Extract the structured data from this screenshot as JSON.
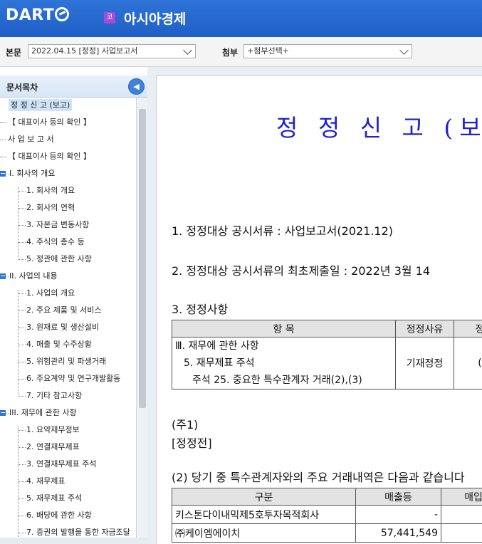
{
  "header": {
    "logo": "DART",
    "company_badge": "코",
    "company_name": "아시아경제"
  },
  "selectors": {
    "main_label": "본문",
    "main_value": "2022.04.15  [정정] 사업보고서",
    "attach_label": "첨부",
    "attach_value": "+첨부선택+"
  },
  "sidebar": {
    "title": "문서목차",
    "items": [
      {
        "label": "정 정 신 고 (보고)"
      },
      {
        "label": "【 대표이사 등의 확인 】"
      },
      {
        "label": "사 업 보 고 서"
      },
      {
        "label": "【 대표이사 등의 확인 】"
      },
      {
        "label": "I. 회사의 개요"
      },
      {
        "label": "1. 회사의 개요"
      },
      {
        "label": "2. 회사의 연혁"
      },
      {
        "label": "3. 자본금 변동사항"
      },
      {
        "label": "4. 주식의 총수 등"
      },
      {
        "label": "5. 정관에 관한 사항"
      },
      {
        "label": "II. 사업의 내용"
      },
      {
        "label": "1. 사업의 개요"
      },
      {
        "label": "2. 주요 제품 및 서비스"
      },
      {
        "label": "3. 원재료 및 생산설비"
      },
      {
        "label": "4. 매출 및 수주상황"
      },
      {
        "label": "5. 위험관리 및 파생거래"
      },
      {
        "label": "6. 주요계약 및 연구개발활동"
      },
      {
        "label": "7. 기타 참고사항"
      },
      {
        "label": "III. 재무에 관한 사항"
      },
      {
        "label": "1. 요약재무정보"
      },
      {
        "label": "2. 연결재무제표"
      },
      {
        "label": "3. 연결재무제표 주석"
      },
      {
        "label": "4. 재무제표"
      },
      {
        "label": "5. 재무제표 주석"
      },
      {
        "label": "6. 배당에 관한 사항"
      },
      {
        "label": "7. 증권의 발행을 통한 자금조달"
      }
    ]
  },
  "document": {
    "title": "정 정 신 고 (보고)",
    "line1": "1. 정정대상 공시서류 : 사업보고서(2021.12)",
    "line2": "2. 정정대상 공시서류의 최초제출일 : 2022년 3월 14",
    "line3": "3. 정정사항",
    "table1": {
      "headers": [
        "항 목",
        "정정사유",
        "정"
      ],
      "row_item_lines": [
        "Ⅲ. 재무에 관한 사항",
        "  5. 재무제표 주석",
        "    주석 25. 중요한 특수관계자 거래(2),(3)"
      ],
      "row_reason": "기재정정",
      "row_extra": "("
    },
    "note1": "(주1)",
    "note2": "[정정전]",
    "line4": "(2) 당기 중 특수관계자와의 주요 거래내역은 다음과 같습니다",
    "table2": {
      "headers": [
        "구분",
        "매출등",
        "매입"
      ],
      "rows": [
        {
          "name": "키스톤다이내믹제5호투자목적회사",
          "sales": "-"
        },
        {
          "name": "㈜케이엠에이치",
          "sales": "57,441,549"
        }
      ]
    }
  }
}
